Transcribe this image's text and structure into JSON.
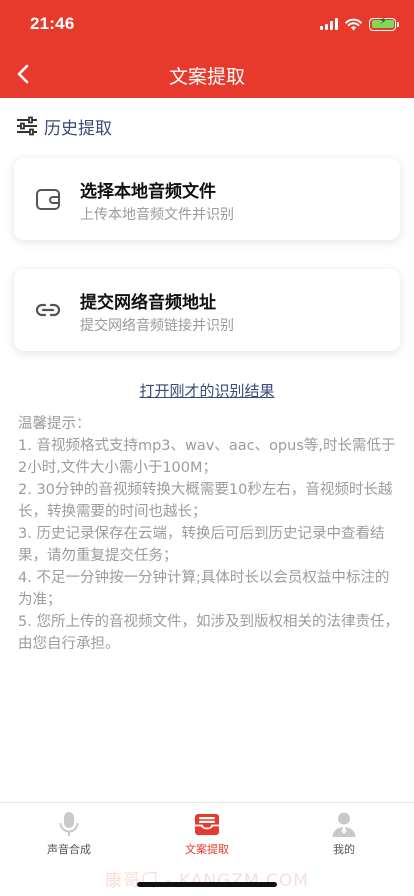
{
  "status_bar": {
    "time": "21:46"
  },
  "navbar": {
    "title": "文案提取"
  },
  "history": {
    "label": "历史提取"
  },
  "cards": [
    {
      "title": "选择本地音频文件",
      "subtitle": "上传本地音频文件并识别",
      "icon": "wallet-icon"
    },
    {
      "title": "提交网络音频地址",
      "subtitle": "提交网络音频链接并识别",
      "icon": "link-icon"
    }
  ],
  "open_result_link": "打开刚才的识别结果",
  "tips": {
    "heading": "温馨提示：",
    "items": [
      "1. 音视频格式支持mp3、wav、aac、opus等,时长需低于2小时,文件大小需小于100M；",
      "2. 30分钟的音视频转换大概需要10秒左右，音视频时长越长，转换需要的时间也越长；",
      "3. 历史记录保存在云端，转换后可后到历史记录中查看结果，请勿重复提交任务；",
      "4. 不足一分钟按一分钟计算;具体时长以会员权益中标注的为准；",
      "5. 您所上传的音视频文件，如涉及到版权相关的法律责任，由您自行承担。"
    ]
  },
  "tabbar": {
    "items": [
      {
        "label": "声音合成",
        "icon": "microphone-icon",
        "active": false
      },
      {
        "label": "文案提取",
        "icon": "inbox-icon",
        "active": true
      },
      {
        "label": "我的",
        "icon": "person-icon",
        "active": false
      }
    ]
  },
  "watermark": "康哥门 - KANGZM.COM",
  "colors": {
    "brand_red": "#e83a2c",
    "link_blue": "#3d4a7a",
    "muted_text": "#9c9c9c"
  }
}
